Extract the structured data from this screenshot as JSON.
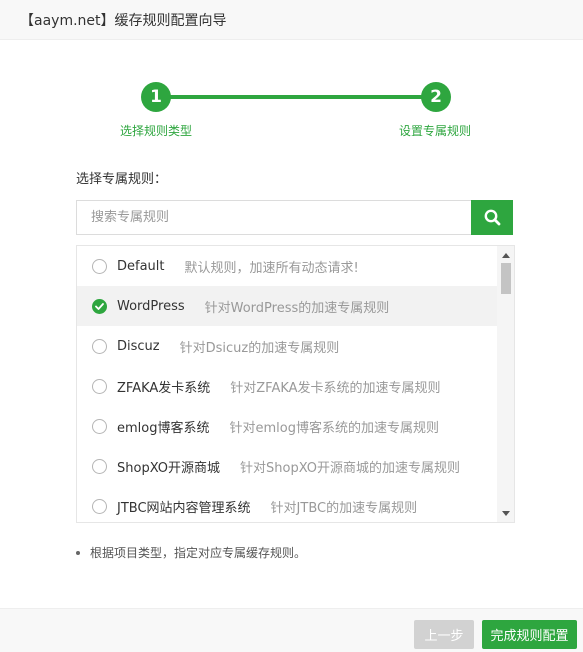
{
  "header": {
    "title": "【aaym.net】缓存规则配置向导"
  },
  "stepper": {
    "steps": [
      {
        "number": "1",
        "label": "选择规则类型"
      },
      {
        "number": "2",
        "label": "设置专属规则"
      }
    ]
  },
  "rule_section": {
    "label": "选择专属规则："
  },
  "search": {
    "placeholder": "搜索专属规则",
    "value": "",
    "button_icon": "search-icon"
  },
  "rules": {
    "selected_index": 1,
    "items": [
      {
        "name": "Default",
        "desc": "默认规则，加速所有动态请求!"
      },
      {
        "name": "WordPress",
        "desc": "针对WordPress的加速专属规则"
      },
      {
        "name": "Discuz",
        "desc": "针对Dsicuz的加速专属规则"
      },
      {
        "name": "ZFAKA发卡系统",
        "desc": "针对ZFAKA发卡系统的加速专属规则"
      },
      {
        "name": "emlog博客系统",
        "desc": "针对emlog博客系统的加速专属规则"
      },
      {
        "name": "ShopXO开源商城",
        "desc": "针对ShopXO开源商城的加速专属规则"
      },
      {
        "name": "JTBC网站内容管理系统",
        "desc": "针对JTBC的加速专属规则"
      }
    ]
  },
  "note": {
    "text": "根据项目类型，指定对应专属缓存规则。"
  },
  "footer": {
    "prev_label": "上一步",
    "finish_label": "完成规则配置"
  },
  "colors": {
    "accent": "#2ea63f",
    "disabled_button": "#d2d2d2"
  }
}
